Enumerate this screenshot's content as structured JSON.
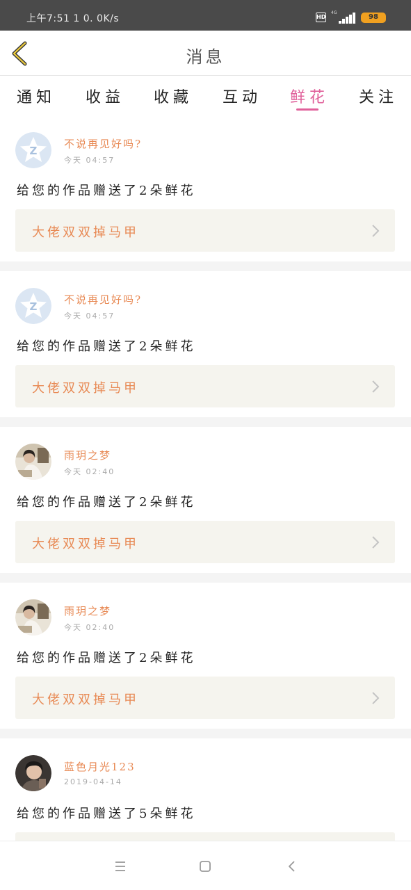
{
  "status_bar": {
    "time": "上午7:51 1 0. 0K/s",
    "hd": "HD",
    "network": "4G",
    "battery": "98"
  },
  "nav": {
    "title": "消息",
    "back_icon": "chevron-left-icon"
  },
  "tabs": [
    {
      "label": "通知",
      "active": false
    },
    {
      "label": "收益",
      "active": false
    },
    {
      "label": "收藏",
      "active": false
    },
    {
      "label": "互动",
      "active": false
    },
    {
      "label": "鲜花",
      "active": true
    },
    {
      "label": "关注",
      "active": false
    }
  ],
  "accent_color": "#e0609a",
  "name_color": "#e88a55",
  "messages": [
    {
      "username": "不说再见好吗?",
      "time": "今天 04:57",
      "text": "给您的作品赠送了2朵鲜花",
      "work_title": "大佬双双掉马甲",
      "avatar": "default-q-avatar"
    },
    {
      "username": "不说再见好吗?",
      "time": "今天 04:57",
      "text": "给您的作品赠送了2朵鲜花",
      "work_title": "大佬双双掉马甲",
      "avatar": "default-q-avatar"
    },
    {
      "username": "雨玥之梦",
      "time": "今天 02:40",
      "text": "给您的作品赠送了2朵鲜花",
      "work_title": "大佬双双掉马甲",
      "avatar": "photo-avatar"
    },
    {
      "username": "雨玥之梦",
      "time": "今天 02:40",
      "text": "给您的作品赠送了2朵鲜花",
      "work_title": "大佬双双掉马甲",
      "avatar": "photo-avatar"
    },
    {
      "username": "蓝色月光123",
      "time": "2019-04-14",
      "text": "给您的作品赠送了5朵鲜花",
      "work_title": "",
      "avatar": "photo-avatar"
    }
  ],
  "system_nav": [
    "menu-icon",
    "home-icon",
    "back-icon"
  ]
}
